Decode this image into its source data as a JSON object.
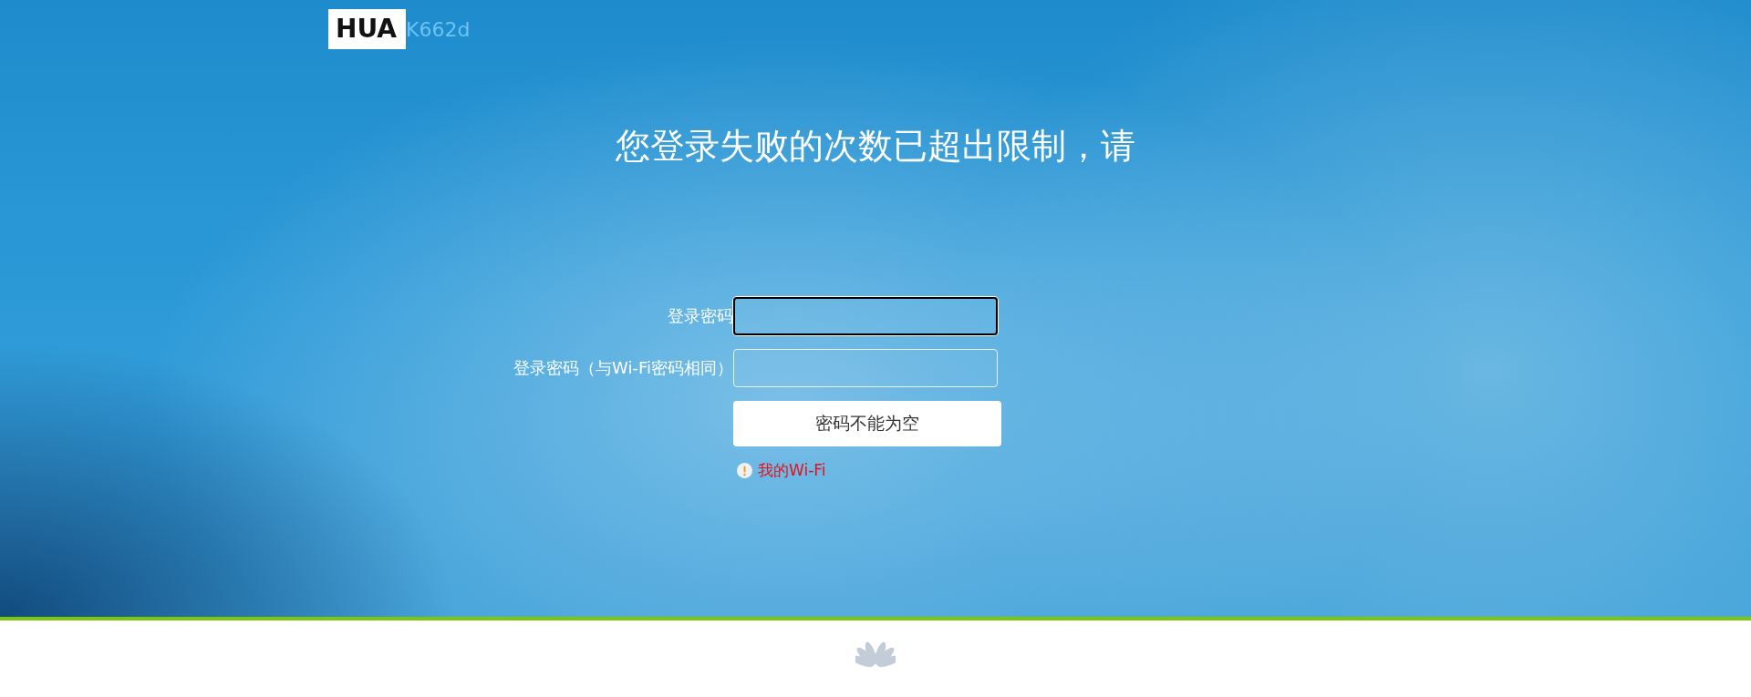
{
  "header": {
    "logo_text": "HUA",
    "model": "K662d"
  },
  "title": "您登录失败的次数已超出限制，请",
  "form": {
    "fields": [
      {
        "label": "登录密码",
        "focused": true
      },
      {
        "label": "登录密码（与Wi-Fi密码相同）",
        "focused": false
      }
    ],
    "button": "密码不能为空",
    "error": "我的Wi-Fi"
  }
}
